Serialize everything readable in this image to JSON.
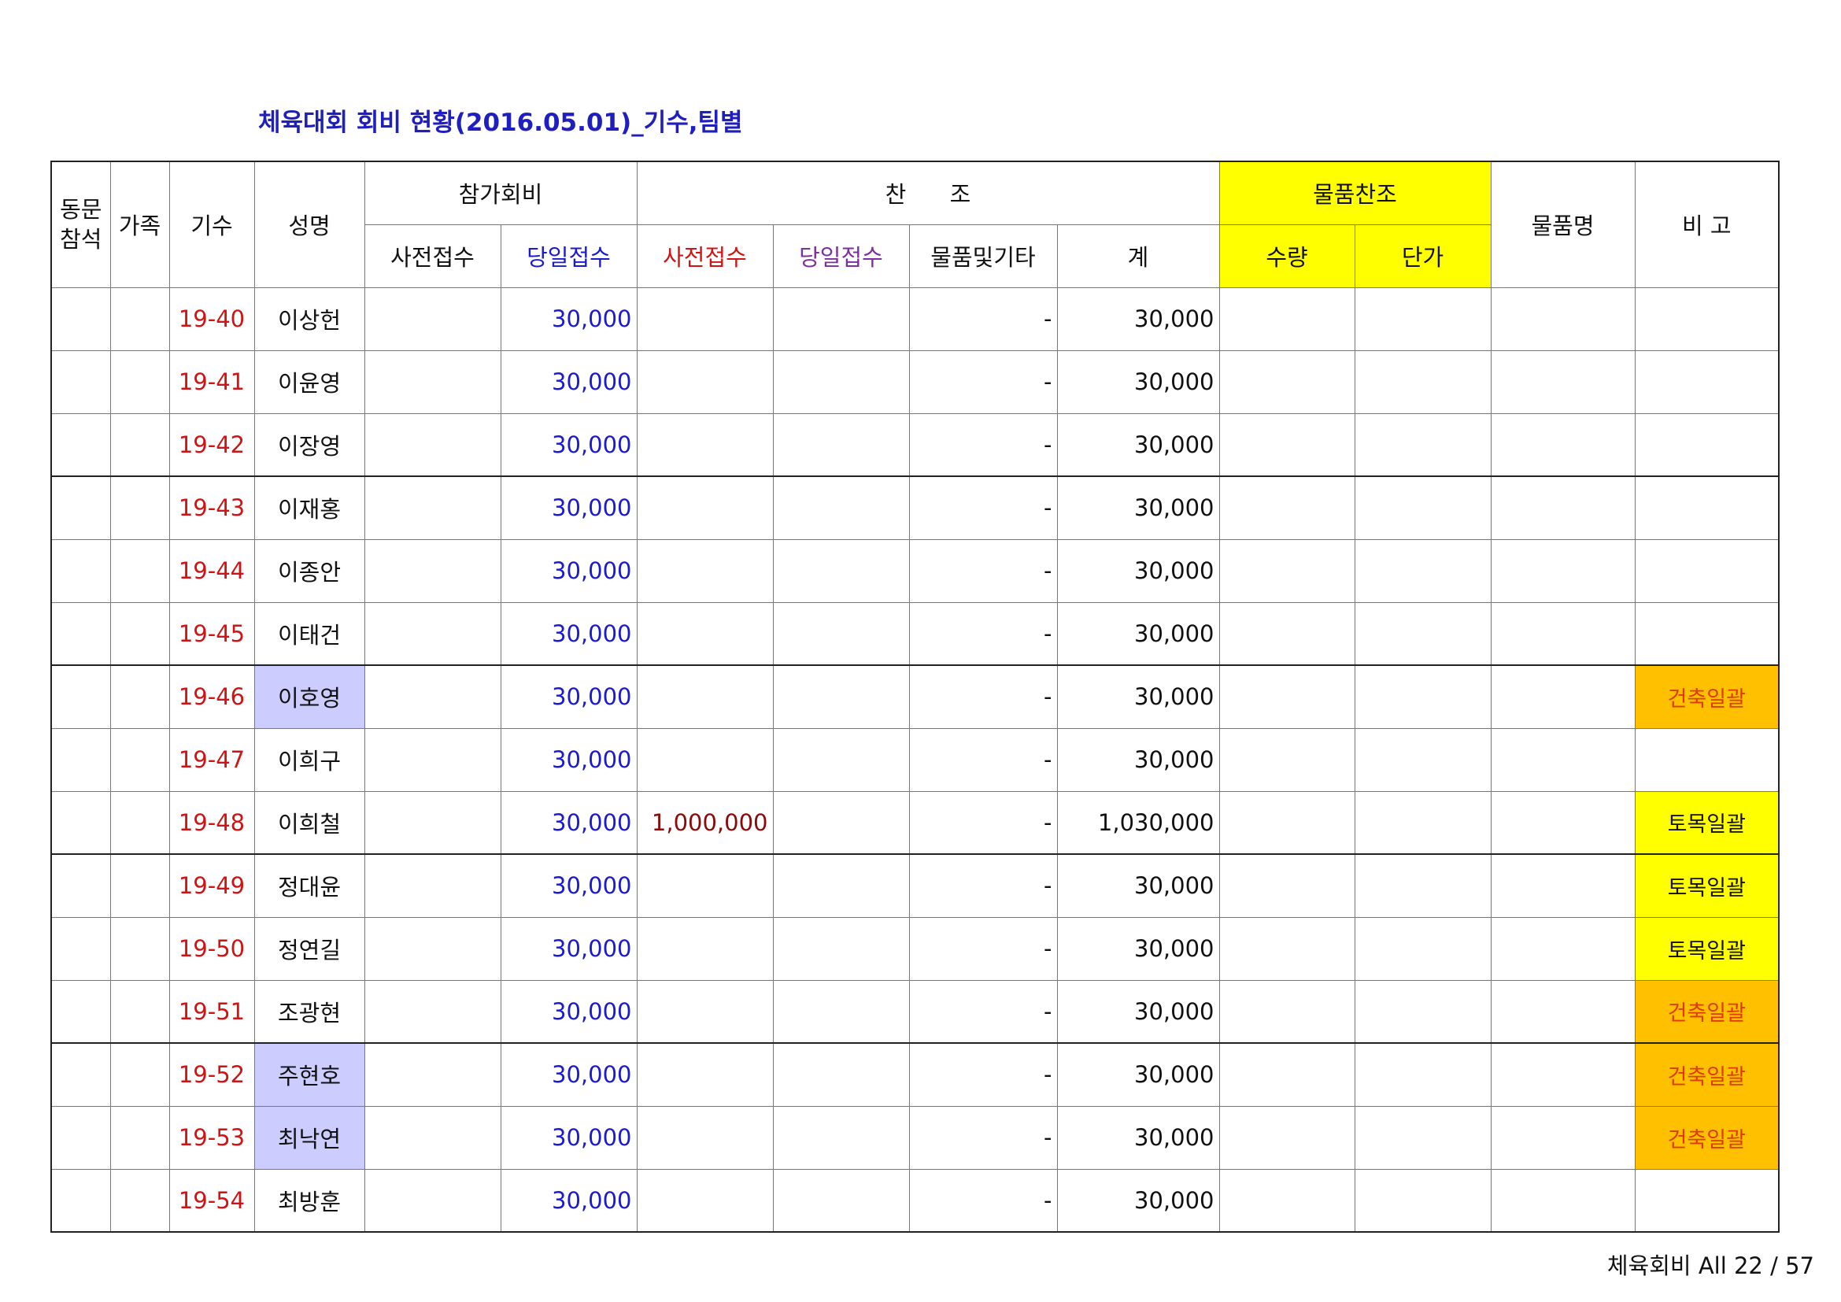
{
  "title": "체육대회 회비 현황(2016.05.01)_기수,팀별",
  "headers": {
    "attend": "동문\n참석",
    "family": "가족",
    "cohort": "기수",
    "name": "성명",
    "fee_group": "참가회비",
    "fee_pre": "사전접수",
    "fee_day": "당일접수",
    "sponsor_group": "찬      조",
    "sp_pre": "사전접수",
    "sp_day": "당일접수",
    "sp_goods": "물품및기타",
    "sp_total": "계",
    "goods_group": "물품찬조",
    "goods_qty": "수량",
    "goods_price": "단가",
    "goods_name": "물품명",
    "remark": "비 고"
  },
  "rows": [
    {
      "cohort": "19-40",
      "name": "이상헌",
      "fee_day": "30,000",
      "sp_pre": "",
      "sp_goods": "-",
      "total": "30,000",
      "remark": "",
      "name_hl": false,
      "remark_style": ""
    },
    {
      "cohort": "19-41",
      "name": "이윤영",
      "fee_day": "30,000",
      "sp_pre": "",
      "sp_goods": "-",
      "total": "30,000",
      "remark": "",
      "name_hl": false,
      "remark_style": ""
    },
    {
      "cohort": "19-42",
      "name": "이장영",
      "fee_day": "30,000",
      "sp_pre": "",
      "sp_goods": "-",
      "total": "30,000",
      "remark": "",
      "name_hl": false,
      "remark_style": ""
    },
    {
      "cohort": "19-43",
      "name": "이재홍",
      "fee_day": "30,000",
      "sp_pre": "",
      "sp_goods": "-",
      "total": "30,000",
      "remark": "",
      "name_hl": false,
      "remark_style": ""
    },
    {
      "cohort": "19-44",
      "name": "이종안",
      "fee_day": "30,000",
      "sp_pre": "",
      "sp_goods": "-",
      "total": "30,000",
      "remark": "",
      "name_hl": false,
      "remark_style": ""
    },
    {
      "cohort": "19-45",
      "name": "이태건",
      "fee_day": "30,000",
      "sp_pre": "",
      "sp_goods": "-",
      "total": "30,000",
      "remark": "",
      "name_hl": false,
      "remark_style": ""
    },
    {
      "cohort": "19-46",
      "name": "이호영",
      "fee_day": "30,000",
      "sp_pre": "",
      "sp_goods": "-",
      "total": "30,000",
      "remark": "건축일괄",
      "name_hl": true,
      "remark_style": "orange"
    },
    {
      "cohort": "19-47",
      "name": "이희구",
      "fee_day": "30,000",
      "sp_pre": "",
      "sp_goods": "-",
      "total": "30,000",
      "remark": "",
      "name_hl": false,
      "remark_style": ""
    },
    {
      "cohort": "19-48",
      "name": "이희철",
      "fee_day": "30,000",
      "sp_pre": "1,000,000",
      "sp_goods": "-",
      "total": "1,030,000",
      "remark": "토목일괄",
      "name_hl": false,
      "remark_style": "yellow"
    },
    {
      "cohort": "19-49",
      "name": "정대윤",
      "fee_day": "30,000",
      "sp_pre": "",
      "sp_goods": "-",
      "total": "30,000",
      "remark": "토목일괄",
      "name_hl": false,
      "remark_style": "yellow"
    },
    {
      "cohort": "19-50",
      "name": "정연길",
      "fee_day": "30,000",
      "sp_pre": "",
      "sp_goods": "-",
      "total": "30,000",
      "remark": "토목일괄",
      "name_hl": false,
      "remark_style": "yellow"
    },
    {
      "cohort": "19-51",
      "name": "조광현",
      "fee_day": "30,000",
      "sp_pre": "",
      "sp_goods": "-",
      "total": "30,000",
      "remark": "건축일괄",
      "name_hl": false,
      "remark_style": "orange"
    },
    {
      "cohort": "19-52",
      "name": "주현호",
      "fee_day": "30,000",
      "sp_pre": "",
      "sp_goods": "-",
      "total": "30,000",
      "remark": "건축일괄",
      "name_hl": true,
      "remark_style": "orange"
    },
    {
      "cohort": "19-53",
      "name": "최낙연",
      "fee_day": "30,000",
      "sp_pre": "",
      "sp_goods": "-",
      "total": "30,000",
      "remark": "건축일괄",
      "name_hl": true,
      "remark_style": "orange"
    },
    {
      "cohort": "19-54",
      "name": "최방훈",
      "fee_day": "30,000",
      "sp_pre": "",
      "sp_goods": "-",
      "total": "30,000",
      "remark": "",
      "name_hl": false,
      "remark_style": ""
    }
  ],
  "footer": "체육회비 All 22 / 57"
}
